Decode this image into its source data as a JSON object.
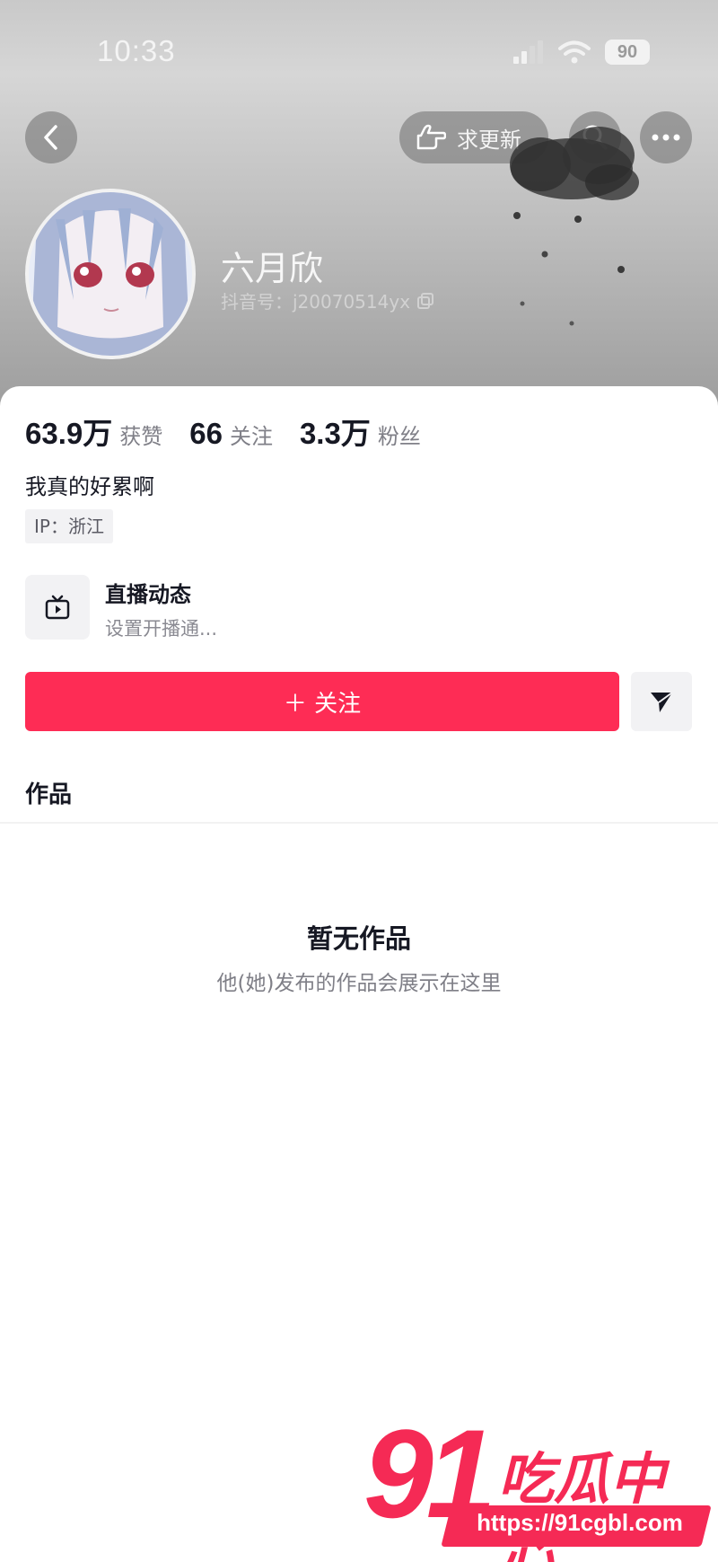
{
  "status_bar": {
    "time": "10:33",
    "battery": "90"
  },
  "header": {
    "update_label": "求更新"
  },
  "profile": {
    "nickname": "六月欣",
    "douyin_id": "抖音号：j20070514yx"
  },
  "stats": [
    {
      "value": "63.9万",
      "label": "获赞"
    },
    {
      "value": "66",
      "label": "关注"
    },
    {
      "value": "3.3万",
      "label": "粉丝"
    }
  ],
  "bio": "我真的好累啊",
  "ip": "IP：浙江",
  "live": {
    "title": "直播动态",
    "subtitle": "设置开播通..."
  },
  "actions": {
    "follow_label": "＋ 关注"
  },
  "tabs": {
    "works": "作品"
  },
  "empty": {
    "title": "暂无作品",
    "subtitle": "他(她)发布的作品会展示在这里"
  },
  "watermark": {
    "number": "91",
    "text": "吃瓜中心",
    "url": "https://91cgbl.com"
  },
  "colors": {
    "accent": "#fe2c55",
    "text": "#161823",
    "muted": "#7f7f87"
  }
}
